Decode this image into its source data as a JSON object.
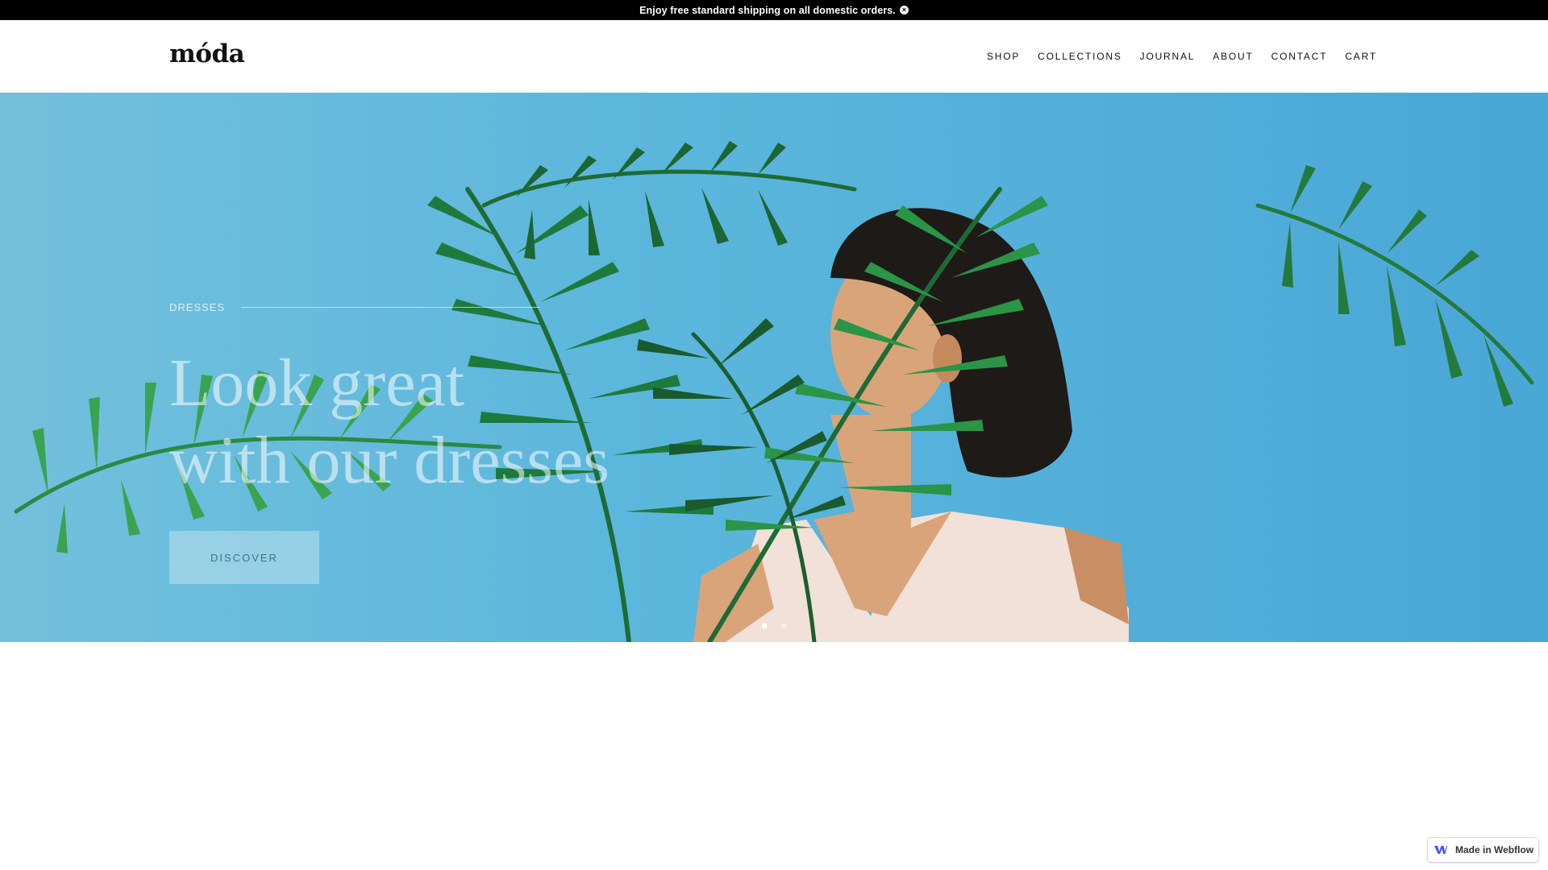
{
  "announcement": {
    "text": "Enjoy free standard shipping on all domestic orders.",
    "close_symbol": "×"
  },
  "header": {
    "logo": "móda",
    "nav": [
      "SHOP",
      "COLLECTIONS",
      "JOURNAL",
      "ABOUT",
      "CONTACT",
      "CART"
    ]
  },
  "hero": {
    "eyebrow": "DRESSES",
    "headline_line1": "Look great",
    "headline_line2": "with our dresses",
    "cta_label": "DISCOVER",
    "slides": {
      "count": 2,
      "active": 1
    },
    "colors": {
      "background": "#5cb7dc",
      "leaf": "#1e7a3c",
      "leaf_light": "#3aa34f",
      "skin": "#d9a47a",
      "hair": "#1e1a18",
      "top": "#f1e1d8"
    }
  },
  "badge": {
    "label": "Made in Webflow",
    "icon": "webflow-icon"
  }
}
